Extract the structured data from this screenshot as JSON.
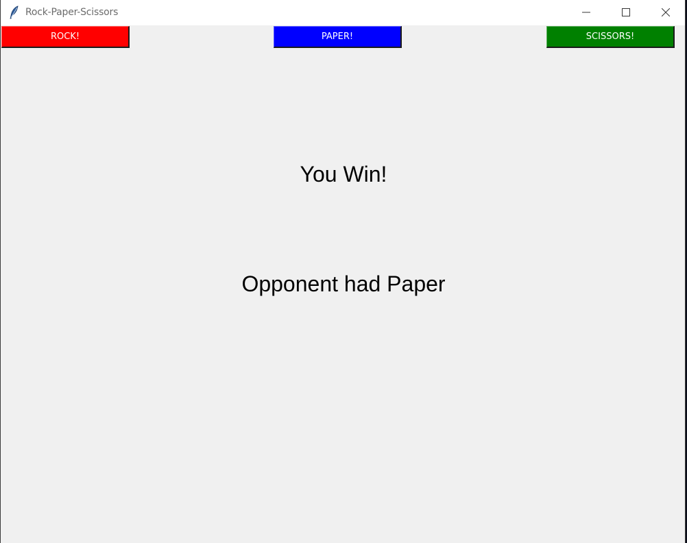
{
  "window": {
    "title": "Rock-Paper-Scissors",
    "icon": "feather-icon",
    "controls": [
      "minimize-icon",
      "maximize-icon",
      "close-icon"
    ]
  },
  "buttons": [
    {
      "label": "ROCK!",
      "color": "#ff0000"
    },
    {
      "label": "PAPER!",
      "color": "#0000ff"
    },
    {
      "label": "SCISSORS!",
      "color": "#008000"
    }
  ],
  "result": {
    "outcome": "You Win!",
    "opponent": "Opponent had Paper"
  }
}
